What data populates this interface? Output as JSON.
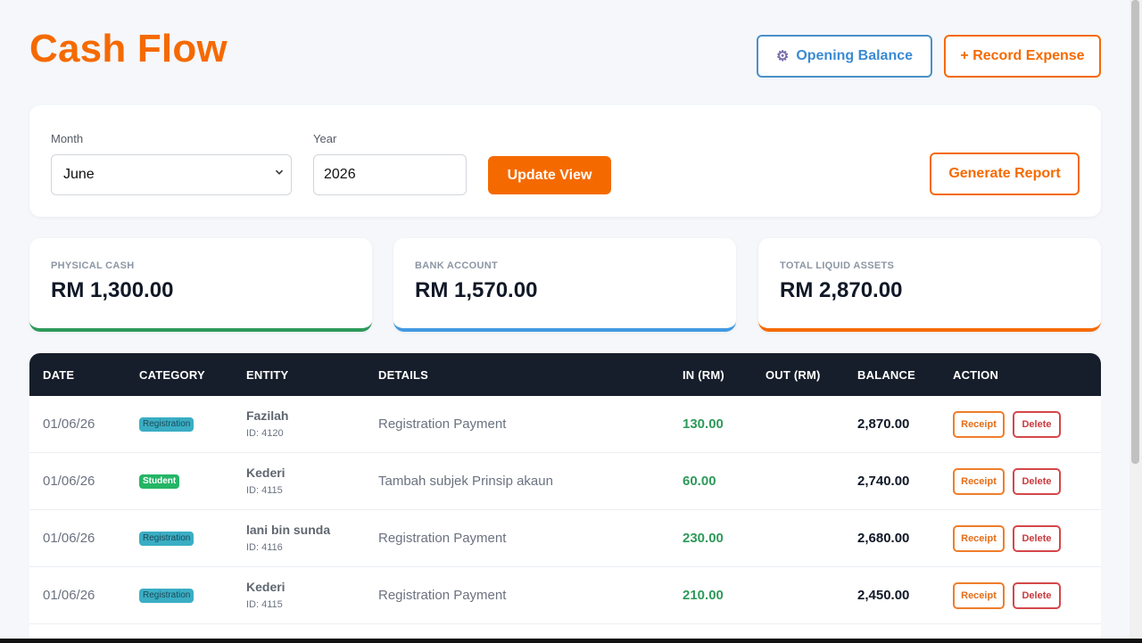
{
  "header": {
    "title": "Cash Flow",
    "opening_balance_label": "Opening Balance",
    "record_expense_label": "+ Record Expense"
  },
  "filters": {
    "month_label": "Month",
    "month_value": "June",
    "year_label": "Year",
    "year_value": "2026",
    "update_label": "Update View",
    "report_label": "Generate Report"
  },
  "stats": [
    {
      "label": "PHYSICAL CASH",
      "value": "RM 1,300.00",
      "color": "#2e9a5a"
    },
    {
      "label": "BANK ACCOUNT",
      "value": "RM 1,570.00",
      "color": "#4299e1"
    },
    {
      "label": "TOTAL LIQUID ASSETS",
      "value": "RM 2,870.00",
      "color": "#f56a00"
    }
  ],
  "table": {
    "columns": [
      "DATE",
      "CATEGORY",
      "ENTITY",
      "DETAILS",
      "IN (RM)",
      "OUT (RM)",
      "BALANCE",
      "ACTION"
    ],
    "receipt_label": "Receipt",
    "delete_label": "Delete",
    "rows": [
      {
        "date": "01/06/26",
        "category": "Registration",
        "entity": "Fazilah",
        "id": "ID: 4120",
        "details": "Registration Payment",
        "in": "130.00",
        "out": "",
        "balance": "2,870.00"
      },
      {
        "date": "01/06/26",
        "category": "Student",
        "entity": "Kederi",
        "id": "ID: 4115",
        "details": "Tambah subjek Prinsip akaun",
        "in": "60.00",
        "out": "",
        "balance": "2,740.00"
      },
      {
        "date": "01/06/26",
        "category": "Registration",
        "entity": "lani bin sunda",
        "id": "ID: 4116",
        "details": "Registration Payment",
        "in": "230.00",
        "out": "",
        "balance": "2,680.00"
      },
      {
        "date": "01/06/26",
        "category": "Registration",
        "entity": "Kederi",
        "id": "ID: 4115",
        "details": "Registration Payment",
        "in": "210.00",
        "out": "",
        "balance": "2,450.00"
      }
    ]
  },
  "colors": {
    "accent": "#f56a00",
    "blue": "#3b8ad4",
    "green": "#2e9a5a",
    "table_header": "#171e2b"
  }
}
